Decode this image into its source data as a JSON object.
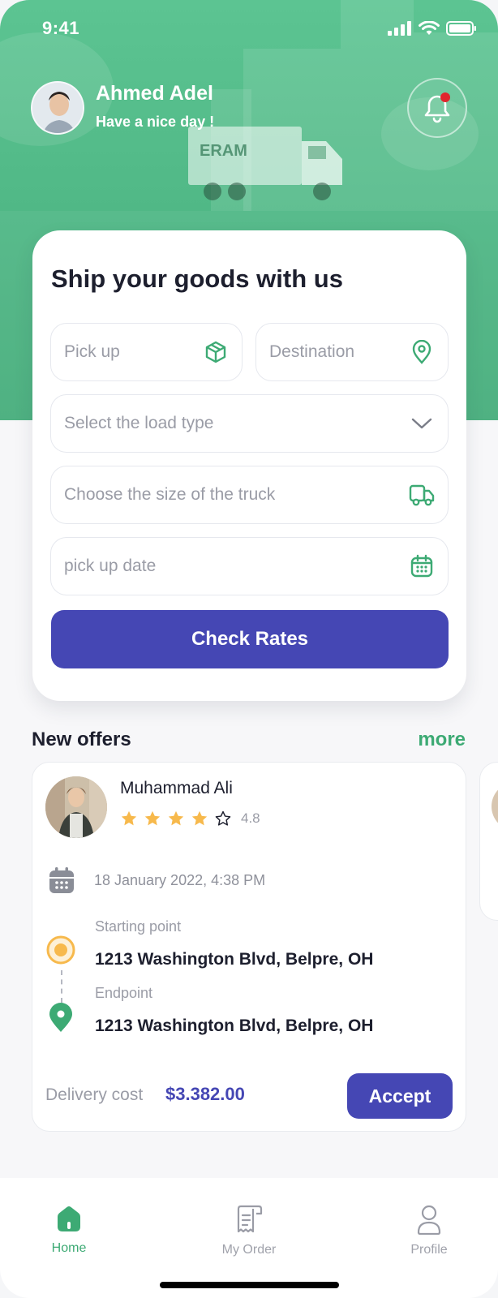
{
  "status_bar": {
    "time": "9:41"
  },
  "header": {
    "user_name": "Ahmed Adel",
    "greeting": "Have a nice day !",
    "truck_brand": "ERAM"
  },
  "ship_card": {
    "title": "Ship your goods with us",
    "pickup_placeholder": "Pick up",
    "destination_placeholder": "Destination",
    "load_type_placeholder": "Select the load type",
    "truck_size_placeholder": "Choose the size of the truck",
    "pickup_date_placeholder": "pick up date",
    "check_rates_label": "Check Rates"
  },
  "offers": {
    "section_title": "New offers",
    "more_label": "more",
    "items": [
      {
        "driver_name": "Muhammad Ali",
        "rating": "4.8",
        "rating_stars_filled": 4,
        "rating_stars_total": 5,
        "date": "18 January 2022, 4:38 PM",
        "start_label": "Starting point",
        "start_address": "1213 Washington Blvd, Belpre, OH",
        "end_label": "Endpoint",
        "end_address": "1213 Washington Blvd, Belpre, OH",
        "cost_label": "Delivery cost",
        "cost_value": "$3.382.00",
        "accept_label": "Accept"
      }
    ]
  },
  "tabbar": {
    "items": [
      {
        "label": "Home",
        "icon": "home-icon",
        "active": true
      },
      {
        "label": "My Order",
        "icon": "receipt-icon",
        "active": false
      },
      {
        "label": "Profile",
        "icon": "user-icon",
        "active": false
      }
    ]
  },
  "colors": {
    "brand_green": "#3daa74",
    "hero_green": "#4fb785",
    "primary_indigo": "#4547b4",
    "star_yellow": "#f7b94c",
    "notification_dot": "#e0262d"
  }
}
